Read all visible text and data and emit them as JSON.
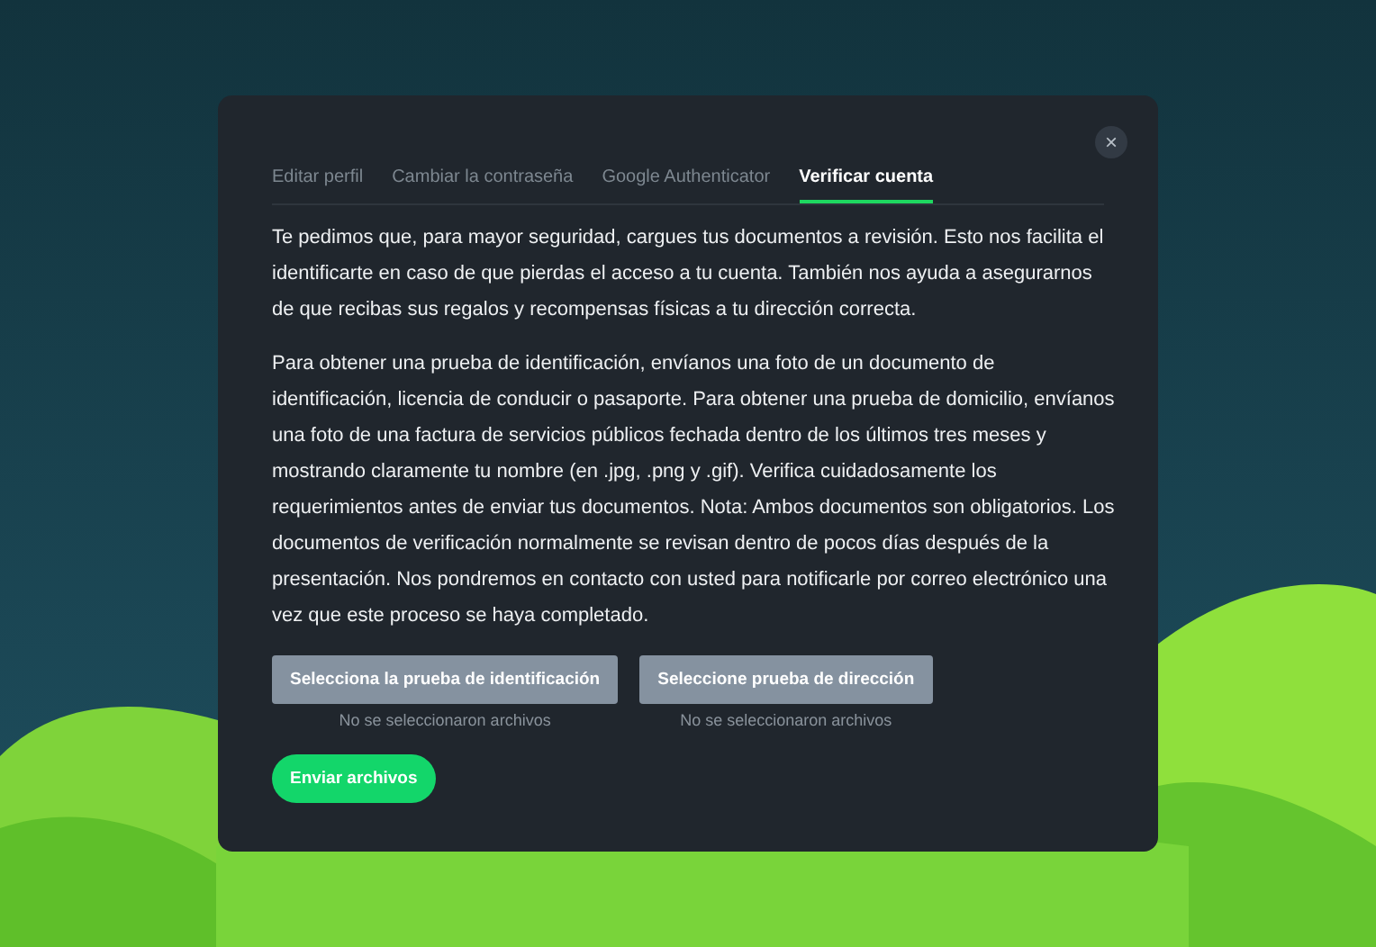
{
  "tabs": [
    {
      "label": "Editar perfil",
      "selected": false
    },
    {
      "label": "Cambiar la contraseña",
      "selected": false
    },
    {
      "label": "Google Authenticator",
      "selected": false
    },
    {
      "label": "Verificar cuenta",
      "selected": true
    }
  ],
  "close": "×",
  "paragraphs": [
    "Te pedimos que, para mayor seguridad, cargues tus documentos a revisión. Esto nos facilita el identificarte en caso de que pierdas el acceso a tu cuenta. También nos ayuda a asegurarnos de que recibas sus regalos y recompensas físicas a tu dirección correcta.",
    "Para obtener una prueba de identificación, envíanos una foto de un documento de identificación, licencia de conducir o pasaporte. Para obtener una prueba de domicilio, envíanos una foto de una factura de servicios públicos fechada dentro de los últimos tres meses y mostrando claramente tu nombre (en .jpg, .png y .gif). Verifica cuidadosamente los requerimientos antes de enviar tus documentos. Nota: Ambos documentos son obligatorios. Los documentos de verificación normalmente se revisan dentro de pocos días después de la presentación. Nos pondremos en contacto con usted para notificarle por correo electrónico una vez que este proceso se haya completado."
  ],
  "uploads": [
    {
      "button": "Selecciona la prueba de identificación",
      "status": "No se seleccionaron archivos"
    },
    {
      "button": "Seleccione prueba de dirección",
      "status": "No se seleccionaron archivos"
    }
  ],
  "submit": "Enviar archivos"
}
